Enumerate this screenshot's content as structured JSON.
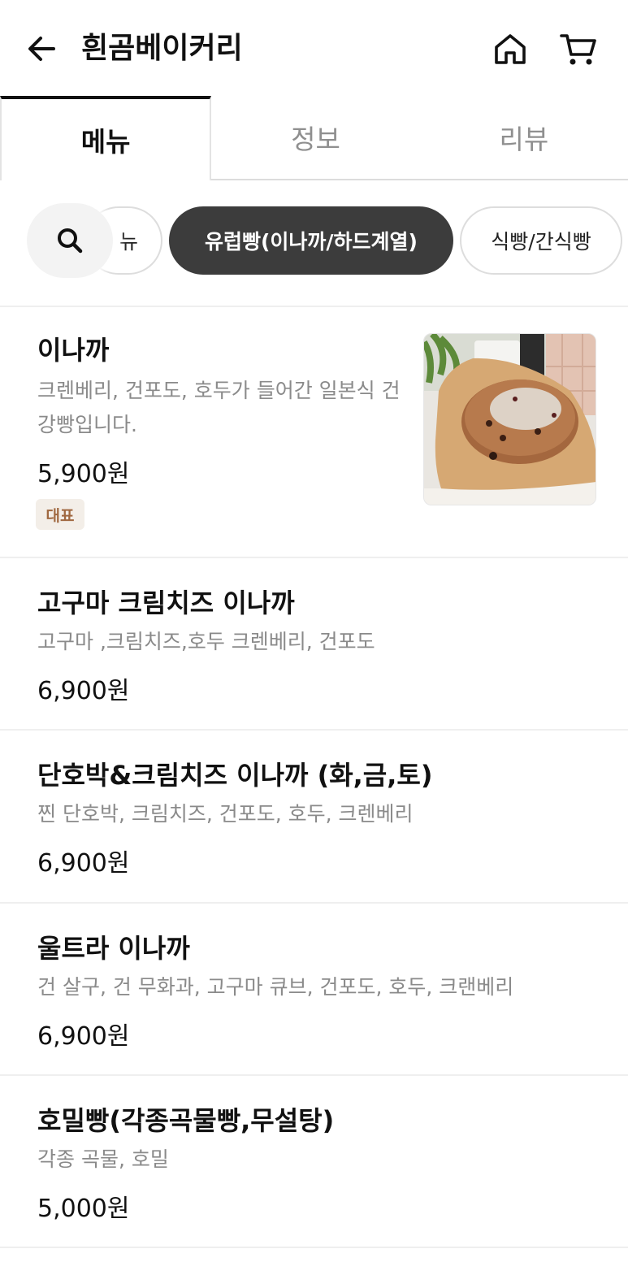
{
  "header": {
    "title": "흰곰베이커리",
    "back_icon": "arrow-left-icon",
    "home_icon": "home-icon",
    "cart_icon": "cart-icon"
  },
  "tabs": [
    {
      "label": "메뉴",
      "active": true
    },
    {
      "label": "정보",
      "active": false
    },
    {
      "label": "리뷰",
      "active": false
    }
  ],
  "categories": {
    "search_icon": "search-icon",
    "partial_label": "뉴",
    "active_label": "유럽빵(이나까/하드계열)",
    "next_label": "식빵/간식빵"
  },
  "menu": [
    {
      "name": "이나까",
      "desc": "크렌베리, 건포도, 호두가 들어간 일본식 건강빵입니다.",
      "price": "5,900원",
      "badge": "대표",
      "image": "bread-photo"
    },
    {
      "name": "고구마 크림치즈 이나까",
      "desc": "고구마 ,크림치즈,호두 크렌베리, 건포도",
      "price": "6,900원"
    },
    {
      "name": "단호박&크림치즈 이나까 (화,금,토)",
      "desc": "찐 단호박, 크림치즈, 건포도, 호두, 크렌베리",
      "price": "6,900원"
    },
    {
      "name": "울트라 이나까",
      "desc": "건 살구, 건 무화과, 고구마 큐브, 건포도, 호두, 크랜베리",
      "price": "6,900원"
    },
    {
      "name": "호밀빵(각종곡물빵,무설탕)",
      "desc": "각종 곡물, 호밀",
      "price": "5,000원"
    }
  ],
  "colors": {
    "active_chip": "#3c3c3c",
    "badge_bg": "#f3eee8",
    "badge_text": "#a06840",
    "muted_text": "#8a8a8a"
  }
}
